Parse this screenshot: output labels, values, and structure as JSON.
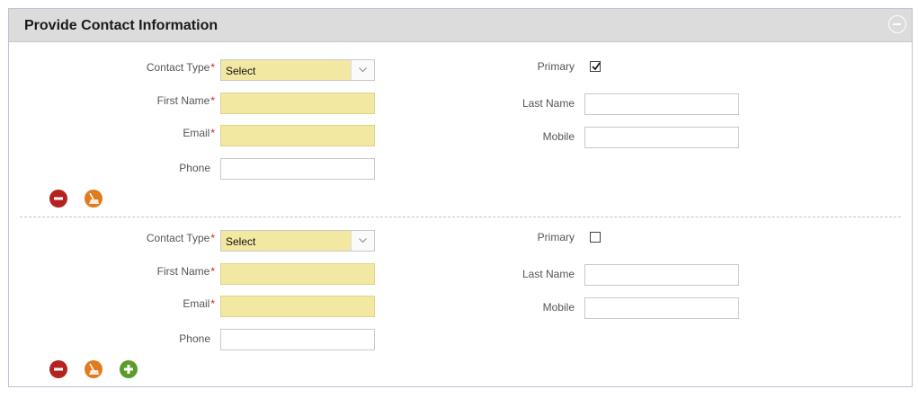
{
  "panel": {
    "title": "Provide Contact Information"
  },
  "labels": {
    "contact_type": "Contact Type",
    "first_name": "First Name",
    "email": "Email",
    "phone": "Phone",
    "primary": "Primary",
    "last_name": "Last Name",
    "mobile": "Mobile",
    "required_mark": "*"
  },
  "contacts": [
    {
      "contact_type_value": "Select",
      "primary_checked": true,
      "first_name": "",
      "last_name": "",
      "email": "",
      "mobile": "",
      "phone": ""
    },
    {
      "contact_type_value": "Select",
      "primary_checked": false,
      "first_name": "",
      "last_name": "",
      "email": "",
      "mobile": "",
      "phone": ""
    }
  ],
  "icons": {
    "collapse": "minus-circle-icon",
    "remove": "remove-icon",
    "clear": "broom-icon",
    "add": "plus-icon"
  },
  "colors": {
    "required_field": "#f3e8a2",
    "remove": "#b5231f",
    "clear": "#e07b1f",
    "add": "#5a9b2a",
    "required_mark": "#d21f1f"
  }
}
